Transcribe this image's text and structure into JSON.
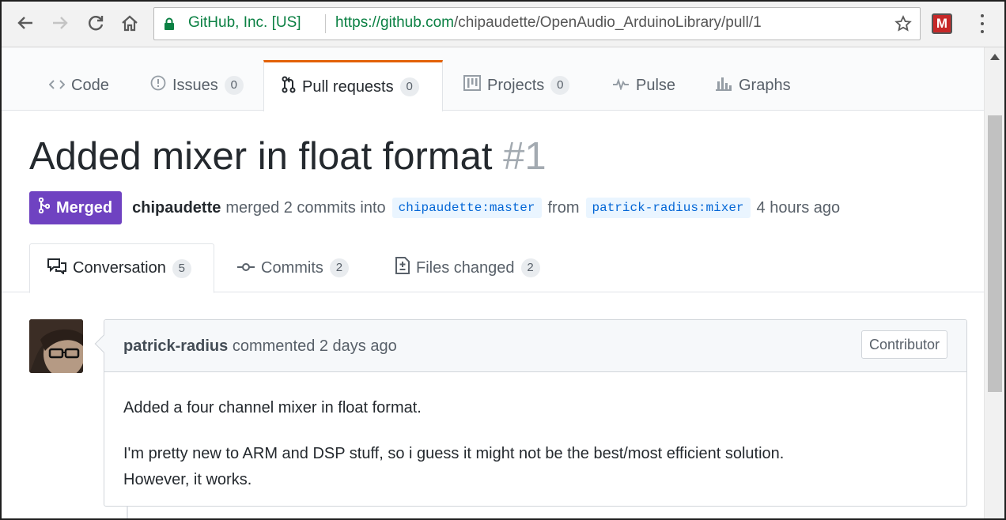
{
  "browser": {
    "secure_label": "GitHub, Inc. [US]",
    "url_prefix": "https://github.com",
    "url_path": "/chipaudette/OpenAudio_ArduinoLibrary/pull/1",
    "extension_label": "M",
    "icons": [
      "back-icon",
      "forward-icon",
      "reload-icon",
      "home-icon",
      "lock-icon",
      "star-icon",
      "menu-icon"
    ]
  },
  "repo_nav": {
    "tabs": [
      {
        "label": "Code",
        "icon": "code-icon"
      },
      {
        "label": "Issues",
        "count": "0",
        "icon": "issue-icon"
      },
      {
        "label": "Pull requests",
        "count": "0",
        "icon": "pull-request-icon",
        "selected": true
      },
      {
        "label": "Projects",
        "count": "0",
        "icon": "project-icon"
      },
      {
        "label": "Pulse",
        "icon": "pulse-icon"
      },
      {
        "label": "Graphs",
        "icon": "graph-icon"
      }
    ]
  },
  "pr": {
    "title": "Added mixer in float format",
    "number": "#1",
    "state": "Merged",
    "author": "chipaudette",
    "action": "merged 2 commits into",
    "base_branch": "chipaudette:master",
    "from_word": "from",
    "head_branch": "patrick-radius:mixer",
    "time": "4 hours ago"
  },
  "pr_tabs": [
    {
      "label": "Conversation",
      "count": "5",
      "icon": "conversation-icon",
      "selected": true
    },
    {
      "label": "Commits",
      "count": "2",
      "icon": "commit-icon"
    },
    {
      "label": "Files changed",
      "count": "2",
      "icon": "diff-icon"
    }
  ],
  "comment": {
    "author": "patrick-radius",
    "action": "commented 2 days ago",
    "badge": "Contributor",
    "paragraph1": "Added a four channel mixer in float format.",
    "paragraph2_line1": "I'm pretty new to ARM and DSP stuff, so i guess it might not be the best/most efficient solution.",
    "paragraph2_line2": "However, it works."
  },
  "colors": {
    "merged": "#6f42c1",
    "selected_tab_accent": "#e36209",
    "secure_green": "#0b8043",
    "branch_bg": "#eaf5ff",
    "branch_text": "#0366d6"
  }
}
